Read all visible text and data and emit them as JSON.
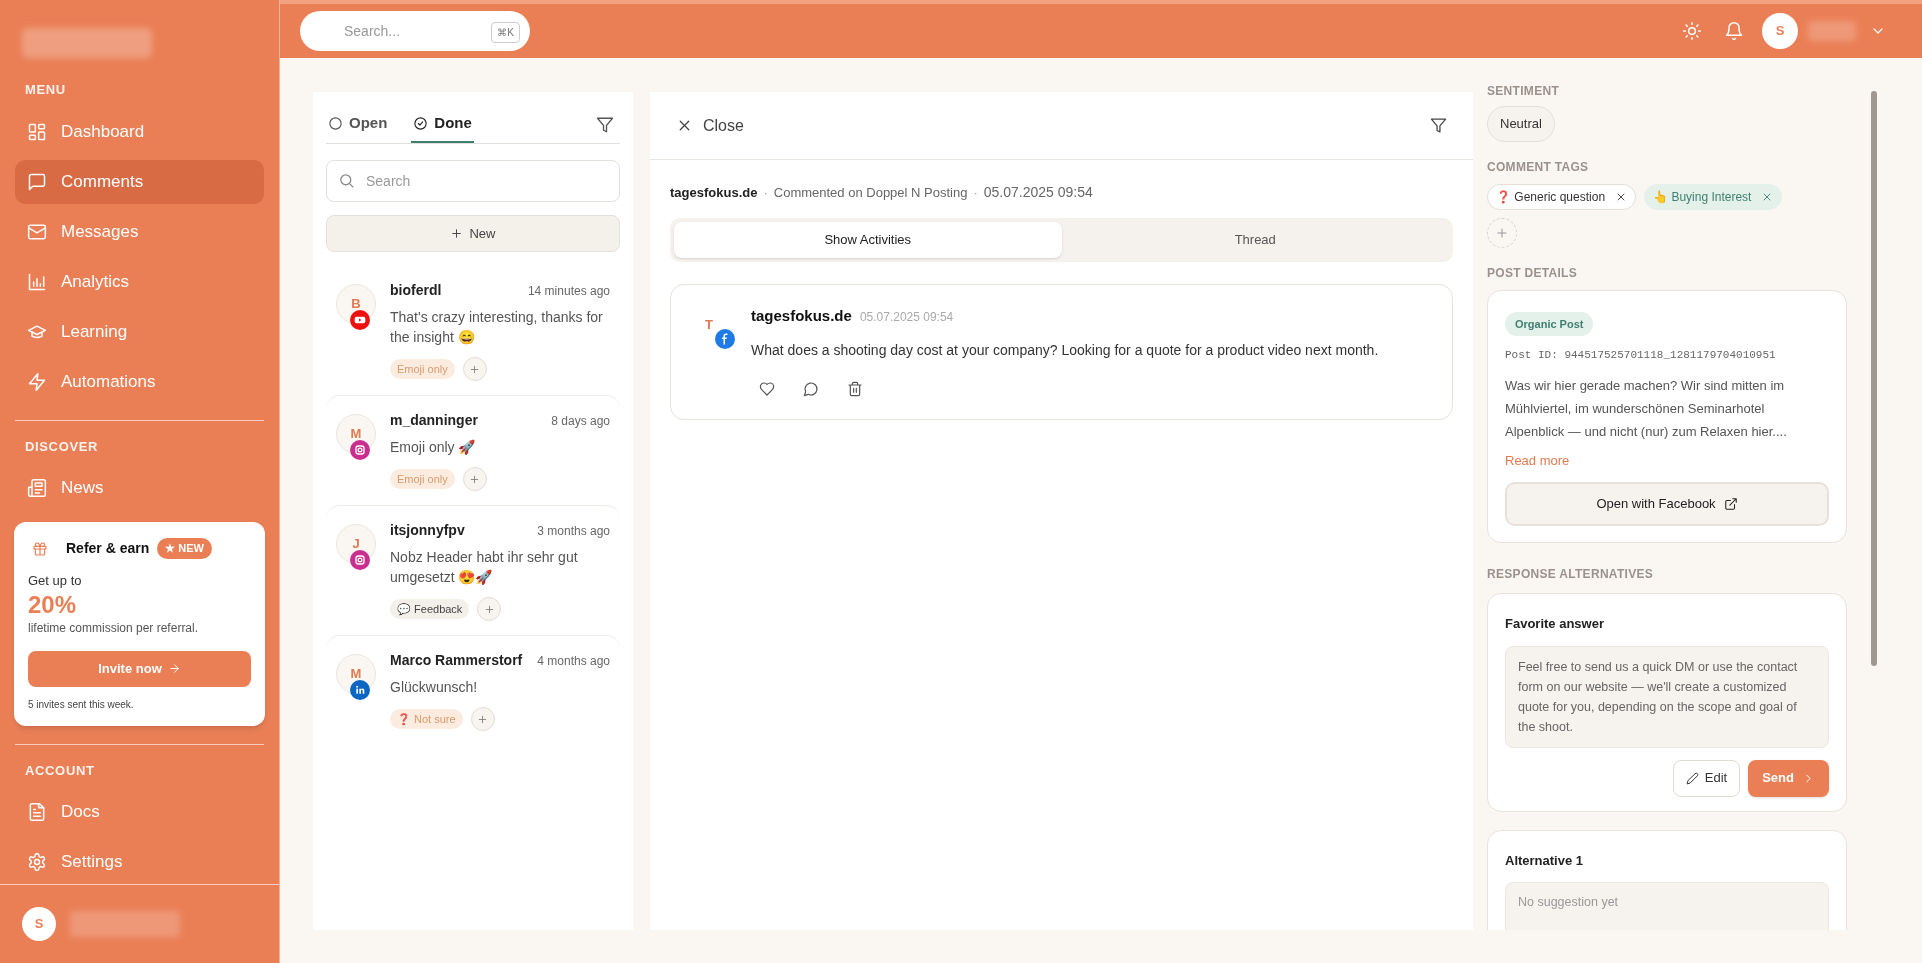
{
  "sidebar": {
    "menu": {
      "title": "MENU",
      "items": [
        {
          "label": "Dashboard",
          "selected": false
        },
        {
          "label": "Comments",
          "selected": true
        },
        {
          "label": "Messages",
          "selected": false
        },
        {
          "label": "Analytics",
          "selected": false
        },
        {
          "label": "Learning",
          "selected": false
        },
        {
          "label": "Automations",
          "selected": false
        }
      ]
    },
    "discover": {
      "title": "DISCOVER",
      "items": [
        {
          "label": "News",
          "selected": false
        }
      ]
    },
    "promo": {
      "title": "Refer & earn",
      "badge": "★ NEW",
      "lead": "Get up to",
      "figure": "20%",
      "text": "lifetime commission per referral.",
      "button": "Invite now",
      "note": "5 invites sent this week."
    },
    "account": {
      "title": "ACCOUNT",
      "items": [
        {
          "label": "Docs",
          "selected": false
        },
        {
          "label": "Settings",
          "selected": false
        }
      ]
    },
    "user": {
      "initial": "S"
    }
  },
  "topbar": {
    "search": {
      "placeholder": "Search...",
      "shortcut": "⌘K"
    },
    "user": {
      "initial": "S"
    }
  },
  "comments": {
    "tabs": [
      {
        "label": "Open",
        "selected": false
      },
      {
        "label": "Done",
        "selected": true
      }
    ],
    "search": {
      "placeholder": "Search"
    },
    "new_button": "New",
    "items": [
      {
        "initial": "B",
        "author": "bioferdl",
        "time": "14 minutes ago",
        "text": "That's crazy interesting, thanks for the insight 😄",
        "kind": "video",
        "color": "#ee0f0f",
        "tags": [
          {
            "label": "Emoji only",
            "kind": "warm"
          }
        ]
      },
      {
        "initial": "M",
        "author": "m_danninger",
        "time": "8 days ago",
        "text": "Emoji only 🚀",
        "kind": "camera",
        "color": "#c92f8f",
        "tags": [
          {
            "label": "Emoji only",
            "kind": "warm"
          }
        ]
      },
      {
        "initial": "J",
        "author": "itsjonnyfpv",
        "time": "3 months ago",
        "text": "Nobz Header habt ihr sehr gut umgesetzt 😍🚀",
        "kind": "camera",
        "color": "#c92f8f",
        "tags": [
          {
            "label": "💬 Feedback",
            "kind": "neutral"
          }
        ]
      },
      {
        "initial": "M",
        "author": "Marco Rammerstorf",
        "time": "4 months ago",
        "text": "Glückwunsch!",
        "kind": "work",
        "color": "#0a66c2",
        "tags": [
          {
            "label": "❓ Not sure",
            "kind": "warm"
          }
        ]
      }
    ]
  },
  "detail": {
    "close": "Close",
    "meta": {
      "author": "tagesfokus.de",
      "separator": "·",
      "context": "Commented on Doppel N Posting",
      "time": "05.07.2025 09:54"
    },
    "tabs": [
      {
        "label": "Show Activities",
        "selected": true
      },
      {
        "label": "Thread",
        "selected": false
      }
    ],
    "activity": {
      "initial": "T",
      "author": "tagesfokus.de",
      "time": "05.07.2025 09:54",
      "text": "What does a shooting day cost at your company? Looking for a quote for a product video next month."
    }
  },
  "info": {
    "sentiment": {
      "heading": "SENTIMENT",
      "value": "Neutral"
    },
    "tags": {
      "heading": "COMMENT TAGS",
      "items": [
        {
          "label": "❓ Generic question",
          "kind": "neutral"
        },
        {
          "label": "👆 Buying Interest",
          "kind": "green"
        }
      ]
    },
    "post": {
      "heading": "POST DETAILS",
      "badge": "Organic Post",
      "post_id": "Post ID: 944517525701118_1281179704010951",
      "text": "Was wir hier gerade machen? Wir sind mitten im Mühlviertel, im wunderschönen Seminarhotel Alpenblick — und nicht (nur) zum Relaxen hier....",
      "read_more": "Read more",
      "button": "Open with Facebook"
    },
    "responses": {
      "heading": "RESPONSE ALTERNATIVES",
      "items": [
        {
          "title": "Favorite answer",
          "text": "Feel free to send us a quick DM or use the contact form on our website — we'll create a customized quote for you, depending on the scope and goal of the shoot.",
          "edit": "Edit",
          "send": "Send"
        },
        {
          "title": "Alternative 1",
          "placeholder": "No suggestion yet"
        }
      ]
    }
  }
}
